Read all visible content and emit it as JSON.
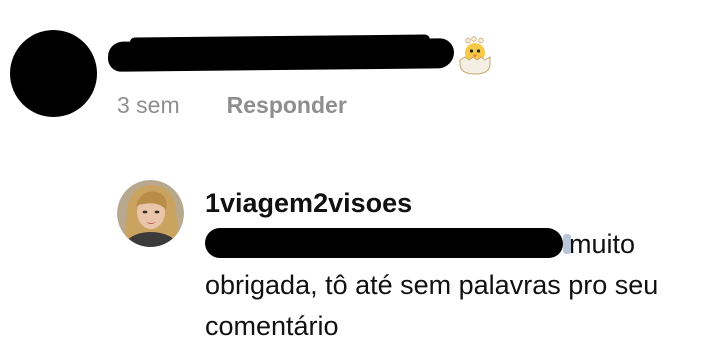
{
  "top_comment": {
    "avatar_icon": "redacted-avatar",
    "username_redacted": true,
    "emoji_icon": "hatching-chick-icon",
    "time": "3 sem",
    "reply_label": "Responder"
  },
  "reply": {
    "avatar_icon": "user-photo-avatar",
    "username": "1viagem2visoes",
    "mention_redacted": true,
    "text_after_mention": "muito obrigada, tô até sem palavras pro seu comentário"
  },
  "colors": {
    "meta_text": "#8e8e8e",
    "primary_text": "#111111",
    "redaction": "#000000",
    "mention_link": "#b7c6da"
  }
}
